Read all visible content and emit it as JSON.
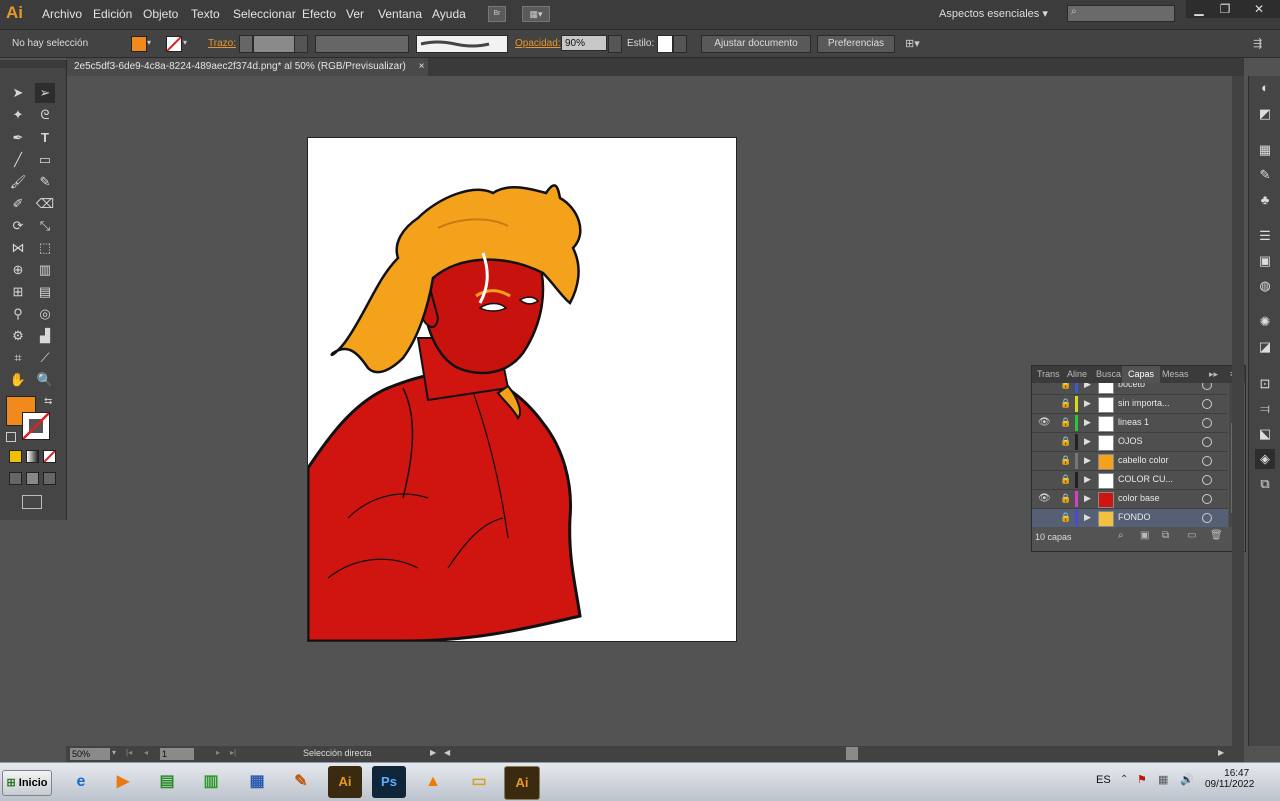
{
  "app": {
    "logo": "Ai"
  },
  "menu": [
    "Archivo",
    "Edición",
    "Objeto",
    "Texto",
    "Seleccionar",
    "Efecto",
    "Ver",
    "Ventana",
    "Ayuda"
  ],
  "workspace": "Aspectos esenciales",
  "control_bar": {
    "selection_status": "No hay selección",
    "stroke_label": "Trazo:",
    "opacity_label": "Opacidad:",
    "opacity_value": "90%",
    "style_label": "Estilo:",
    "fit_document_button": "Ajustar documento",
    "preferences_button": "Preferencias"
  },
  "document_tab": {
    "title": "2e5c5df3-6de9-4c8a-8224-489aec2f374d.png* al 50% (RGB/Previsualizar)",
    "close": "×"
  },
  "colors": {
    "fill": "#f08a1c",
    "accent": "#e8962a",
    "skin": "#d01410",
    "hair": "#f4a21b"
  },
  "layers_panel": {
    "tabs": [
      "Trans",
      "Aline",
      "Busca",
      "Capas",
      "Mesas"
    ],
    "active_tab": "Capas",
    "layers": [
      {
        "name": "boceto",
        "visible": false,
        "color": "#3a5bd0"
      },
      {
        "name": "sin importa...",
        "visible": false,
        "color": "#d8d820"
      },
      {
        "name": "lineas 1",
        "visible": true,
        "color": "#2ec43a"
      },
      {
        "name": "OJOS",
        "visible": false,
        "color": "#222222"
      },
      {
        "name": "cabello color",
        "visible": false,
        "color": "#777777"
      },
      {
        "name": "COLOR CU...",
        "visible": false,
        "color": "#222222"
      },
      {
        "name": "color base",
        "visible": true,
        "color": "#d040c8"
      },
      {
        "name": "FONDO",
        "visible": false,
        "color": "#4a4ad8"
      }
    ],
    "count_label": "10 capas"
  },
  "status_bar": {
    "zoom": "50%",
    "artboard": "1",
    "tool_status": "Selección directa"
  },
  "taskbar": {
    "start": "Inicio",
    "language": "ES",
    "time": "16:47",
    "date": "09/11/2022",
    "apps": [
      "ie-icon",
      "media-icon",
      "monitor-icon",
      "chart-icon",
      "calendar-icon",
      "paint-icon",
      "ai-icon",
      "ps-icon",
      "vlc-icon",
      "folder-icon",
      "ai-icon"
    ]
  }
}
